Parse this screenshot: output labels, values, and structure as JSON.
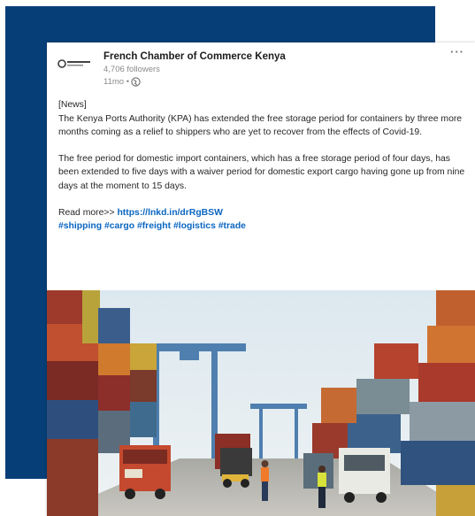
{
  "post": {
    "author": "French Chamber of Commerce Kenya",
    "followers": "4,706 followers",
    "time": "11mo •",
    "more_label": "···",
    "tag_label": "[News]",
    "paragraph1": "The Kenya Ports Authority (KPA) has extended the free storage period for containers by three more months coming as a relief to shippers who are yet to recover from the effects of Covid-19.",
    "paragraph2": "The free period for domestic import containers, which has a free storage period of four days, has been extended to five days with a waiver period for domestic export cargo having gone up from nine days at the moment to 15 days.",
    "read_more_prefix": "Read more>> ",
    "read_more_link": "https://lnkd.in/drRgBSW",
    "hashtags": [
      "#shipping",
      "#cargo",
      "#freight",
      "#logistics",
      "#trade"
    ]
  },
  "icons": {
    "logo": "company-logo-icon",
    "visibility": "globe-icon",
    "menu": "more-options-icon"
  },
  "colors": {
    "backdrop": "#063f77",
    "link": "#0a66c2",
    "text": "#262626",
    "muted": "#8a8a8a"
  }
}
